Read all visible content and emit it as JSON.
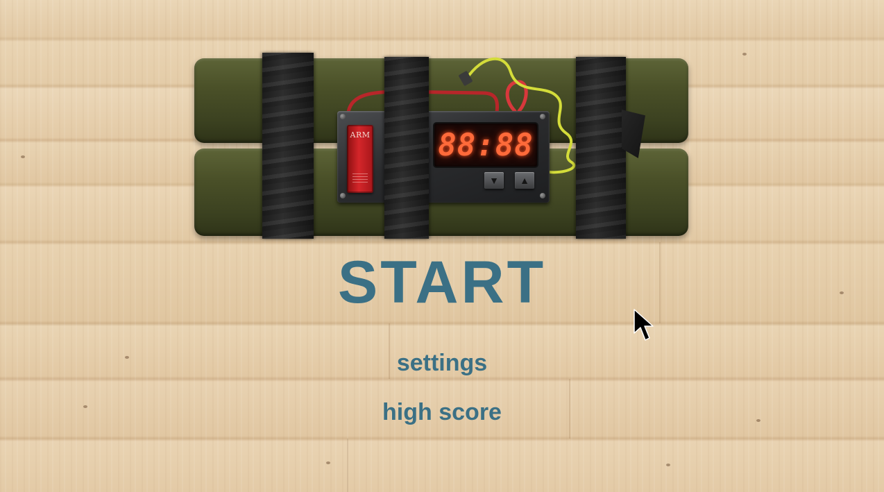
{
  "bomb": {
    "arm_label": "ARM",
    "timer_display": "88:88",
    "down_arrow_icon": "triangle-down",
    "up_arrow_icon": "triangle-up"
  },
  "menu": {
    "start_label": "START",
    "settings_label": "settings",
    "high_score_label": "high score"
  },
  "colors": {
    "menu_text": "#3b7085",
    "timer_digits": "#ff6a3a",
    "arm_switch": "#d4262a",
    "bomb_body": "#4a5028",
    "background_wood": "#e6cfae"
  },
  "cursor_icon": "arrow-pointer"
}
